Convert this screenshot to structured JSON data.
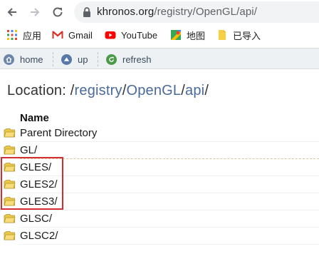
{
  "browser": {
    "url_host": "khronos.org",
    "url_path": "/registry/OpenGL/api/"
  },
  "bookmarks": [
    {
      "label": "应用",
      "icon": "apps-grid-icon"
    },
    {
      "label": "Gmail",
      "icon": "gmail-icon"
    },
    {
      "label": "YouTube",
      "icon": "youtube-icon"
    },
    {
      "label": "地图",
      "icon": "maps-icon"
    },
    {
      "label": "已导入",
      "icon": "folder-icon"
    }
  ],
  "page_toolbar": {
    "home": "home",
    "up": "up",
    "refresh": "refresh"
  },
  "location": {
    "label": "Location:",
    "separator": "/",
    "segments": [
      "registry",
      "OpenGL",
      "api"
    ]
  },
  "listing": {
    "header": "Name",
    "entries": [
      "Parent Directory",
      "GL/",
      "GLES/",
      "GLES2/",
      "GLES3/",
      "GLSC/",
      "GLSC2/"
    ]
  },
  "colors": {
    "highlight": "#d42d32",
    "link": "#4a6a9a"
  }
}
